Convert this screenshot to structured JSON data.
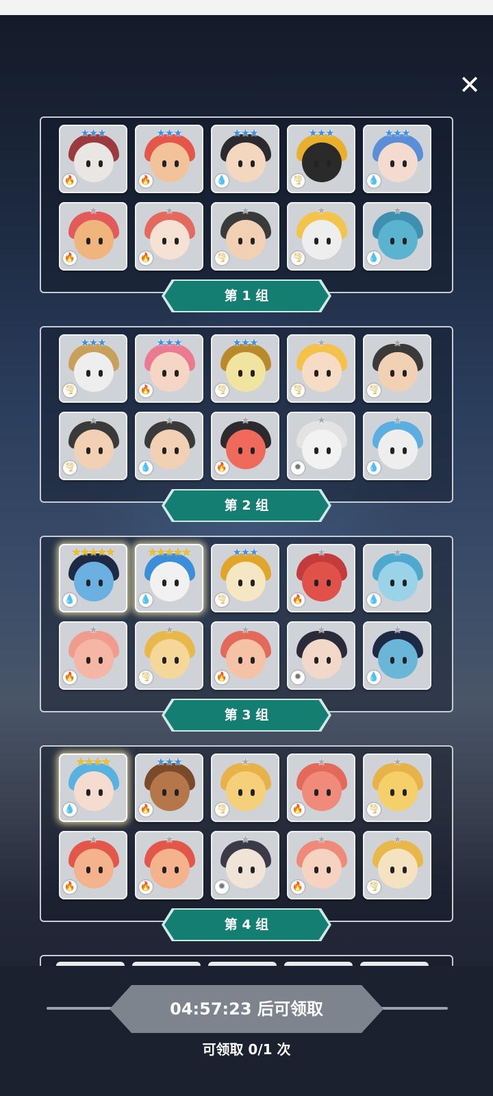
{
  "close_icon": "close-icon",
  "groups": [
    {
      "label": "第 1 组",
      "heroes": [
        {
          "stars": "★★★",
          "tier": "blue",
          "element": "fire",
          "color": "#e9e6e3",
          "hair": "#9b3a3f"
        },
        {
          "stars": "★★★",
          "tier": "blue",
          "element": "fire",
          "color": "#f2c39a",
          "hair": "#e4564a"
        },
        {
          "stars": "★★★",
          "tier": "blue",
          "element": "water",
          "color": "#f3d7bf",
          "hair": "#2c2a2e"
        },
        {
          "stars": "★★★",
          "tier": "blue",
          "element": "wind",
          "color": "#2a2a2a",
          "hair": "#e9b02e"
        },
        {
          "stars": "★★★",
          "tier": "blue",
          "element": "water",
          "color": "#f3dccf",
          "hair": "#5a8fd8"
        },
        {
          "stars": "★",
          "tier": "silver",
          "element": "fire",
          "color": "#f0b57d",
          "hair": "#e35a5a"
        },
        {
          "stars": "★",
          "tier": "silver",
          "element": "fire",
          "color": "#f6e2d5",
          "hair": "#e36a5d"
        },
        {
          "stars": "★",
          "tier": "silver",
          "element": "wind",
          "color": "#f2d0b4",
          "hair": "#3a3a3a"
        },
        {
          "stars": "★",
          "tier": "silver",
          "element": "wind",
          "color": "#eee",
          "hair": "#f2c54a"
        },
        {
          "stars": "★",
          "tier": "silver",
          "element": "water",
          "color": "#5ab4cf",
          "hair": "#3f8fb0"
        }
      ]
    },
    {
      "label": "第 2 组",
      "heroes": [
        {
          "stars": "★★★",
          "tier": "blue",
          "element": "wind",
          "color": "#eee",
          "hair": "#c9a05b"
        },
        {
          "stars": "★★★",
          "tier": "blue",
          "element": "fire",
          "color": "#f5d6c4",
          "hair": "#e97a92"
        },
        {
          "stars": "★★★",
          "tier": "blue",
          "element": "wind",
          "color": "#f0e4a0",
          "hair": "#b88a2a"
        },
        {
          "stars": "★",
          "tier": "silver",
          "element": "wind",
          "color": "#f6dcc5",
          "hair": "#f4c24a"
        },
        {
          "stars": "★",
          "tier": "silver",
          "element": "wind",
          "color": "#f2d0b4",
          "hair": "#3a3a3a"
        },
        {
          "stars": "★",
          "tier": "silver",
          "element": "wind",
          "color": "#f2d0b4",
          "hair": "#3a3a3a"
        },
        {
          "stars": "★",
          "tier": "silver",
          "element": "water",
          "color": "#f2d0b4",
          "hair": "#3a3a3a"
        },
        {
          "stars": "★",
          "tier": "silver",
          "element": "fire",
          "color": "#ef6a5a",
          "hair": "#2c2a2e"
        },
        {
          "stars": "★",
          "tier": "silver",
          "element": "light",
          "color": "#f2f2f2",
          "hair": "#e3e3e3"
        },
        {
          "stars": "★",
          "tier": "silver",
          "element": "water",
          "color": "#eee",
          "hair": "#5aaee0"
        }
      ]
    },
    {
      "label": "第 3 组",
      "heroes": [
        {
          "stars": "★★★★★",
          "tier": "gold",
          "element": "water",
          "color": "#6ab0e0",
          "hair": "#1e2a44",
          "glow": true
        },
        {
          "stars": "★★★★★",
          "tier": "gold",
          "element": "water",
          "color": "#f1f1f1",
          "hair": "#3b8ed8",
          "glow": true
        },
        {
          "stars": "★★★",
          "tier": "blue",
          "element": "wind",
          "color": "#f5e6c4",
          "hair": "#e0a52a"
        },
        {
          "stars": "★",
          "tier": "silver",
          "element": "fire",
          "color": "#e0514a",
          "hair": "#c23c3c"
        },
        {
          "stars": "★",
          "tier": "silver",
          "element": "water",
          "color": "#9ad3e8",
          "hair": "#4fa9cf"
        },
        {
          "stars": "★",
          "tier": "silver",
          "element": "fire",
          "color": "#f6b6a6",
          "hair": "#ef9c8c"
        },
        {
          "stars": "★",
          "tier": "silver",
          "element": "wind",
          "color": "#f5d79a",
          "hair": "#e9b84a"
        },
        {
          "stars": "★",
          "tier": "silver",
          "element": "fire",
          "color": "#f6c2a6",
          "hair": "#e36a5a"
        },
        {
          "stars": "★",
          "tier": "silver",
          "element": "light",
          "color": "#f2d8c8",
          "hair": "#2a2a3a"
        },
        {
          "stars": "★",
          "tier": "silver",
          "element": "water",
          "color": "#69b6d8",
          "hair": "#1e2a44"
        }
      ]
    },
    {
      "label": "第 4 组",
      "heroes": [
        {
          "stars": "★★★★",
          "tier": "gold",
          "element": "water",
          "color": "#f4ddd0",
          "hair": "#58b2e0",
          "glow": true
        },
        {
          "stars": "★★★",
          "tier": "blue",
          "element": "fire",
          "color": "#b5774a",
          "hair": "#7a4a2a"
        },
        {
          "stars": "★",
          "tier": "silver",
          "element": "wind",
          "color": "#f5cf7a",
          "hair": "#e8b24a"
        },
        {
          "stars": "★",
          "tier": "silver",
          "element": "fire",
          "color": "#f08a7a",
          "hair": "#e36a5a"
        },
        {
          "stars": "★",
          "tier": "silver",
          "element": "wind",
          "color": "#f5cf6a",
          "hair": "#e8b24a"
        },
        {
          "stars": "★",
          "tier": "silver",
          "element": "fire",
          "color": "#f4b38c",
          "hair": "#e3564a"
        },
        {
          "stars": "★",
          "tier": "silver",
          "element": "fire",
          "color": "#f4b38c",
          "hair": "#e3564a"
        },
        {
          "stars": "★",
          "tier": "silver",
          "element": "light",
          "color": "#f0e4d8",
          "hair": "#3c3a48"
        },
        {
          "stars": "★",
          "tier": "silver",
          "element": "fire",
          "color": "#f6d2c0",
          "hair": "#ef8a7a"
        },
        {
          "stars": "★",
          "tier": "silver",
          "element": "wind",
          "color": "#f4e2c0",
          "hair": "#e9b84a"
        }
      ]
    }
  ],
  "element_icons": {
    "fire": "🔥",
    "water": "💧",
    "wind": "🌪",
    "light": "✹"
  },
  "claim": {
    "button_label": "04:57:23 后可领取",
    "count_text": "可领取 0/1 次"
  }
}
